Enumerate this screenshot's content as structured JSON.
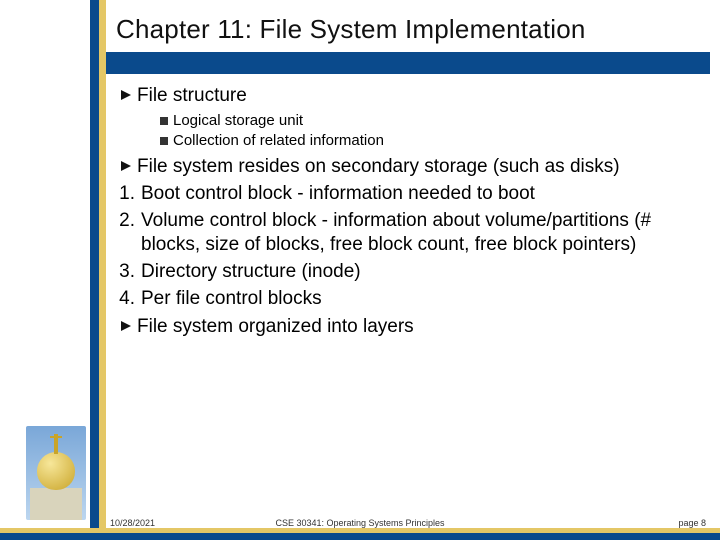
{
  "title": "Chapter 11: File System Implementation",
  "content": {
    "b1": {
      "text": "File structure"
    },
    "b1sub": [
      "Logical storage unit",
      "Collection of related information"
    ],
    "b2": {
      "text": "File system resides on secondary storage (such as disks)"
    },
    "numbered": [
      {
        "n": "1.",
        "text": "Boot control block - information needed to boot"
      },
      {
        "n": "2.",
        "text": "Volume control block - information about volume/partitions (# blocks, size of blocks, free block count, free block pointers)"
      },
      {
        "n": "3.",
        "text": "Directory structure (inode)"
      },
      {
        "n": "4.",
        "text": "Per file control blocks"
      }
    ],
    "b3": {
      "text": "File system organized into layers"
    }
  },
  "footer": {
    "left": "10/28/2021",
    "center": "CSE 30341: Operating Systems Principles",
    "right": "page 8"
  }
}
